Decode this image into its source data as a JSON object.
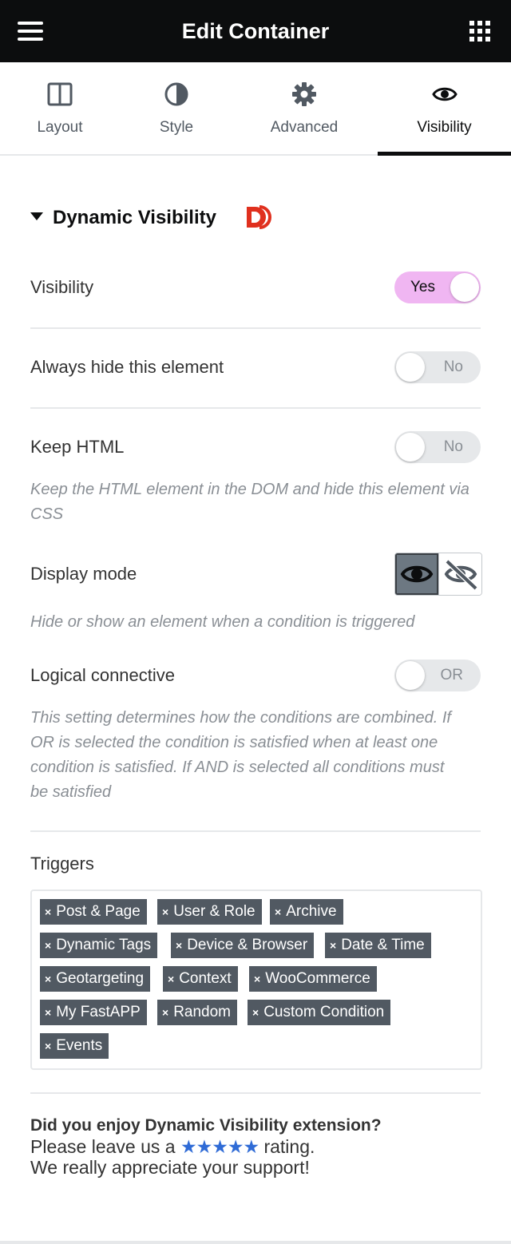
{
  "header": {
    "title": "Edit Container",
    "menu_icon": "hamburger-icon",
    "apps_icon": "grid-icon"
  },
  "tabs": [
    {
      "label": "Layout",
      "icon": "layout-icon"
    },
    {
      "label": "Style",
      "icon": "contrast-icon"
    },
    {
      "label": "Advanced",
      "icon": "gear-icon"
    },
    {
      "label": "Visibility",
      "icon": "eye-icon",
      "active": true
    }
  ],
  "section": {
    "title": "Dynamic Visibility",
    "logo_icon": "dynamic-logo-icon",
    "logo_text": "D"
  },
  "controls": {
    "visibility": {
      "label": "Visibility",
      "state": "Yes"
    },
    "always_hide": {
      "label": "Always hide this element",
      "state": "No"
    },
    "keep_html": {
      "label": "Keep HTML",
      "state": "No",
      "help": "Keep the HTML element in the DOM and hide this element via CSS"
    },
    "display_mode": {
      "label": "Display mode",
      "options": [
        "eye-icon",
        "eye-slash-icon"
      ],
      "selected": "eye-icon",
      "help": "Hide or show an element when a condition is triggered"
    },
    "logical_connective": {
      "label": "Logical connective",
      "state": "OR",
      "help": "This setting determines how the conditions are combined. If OR is selected the condition is satisfied when at least one condition is satisfied. If AND is selected all conditions must be satisfied"
    }
  },
  "triggers": {
    "label": "Triggers",
    "remove_glyph": "×",
    "tags": [
      "Post & Page",
      "User & Role",
      "Archive",
      "Dynamic Tags",
      "Device & Browser",
      "Date & Time",
      "Geotargeting",
      "Context",
      "WooCommerce",
      "My FastAPP",
      "Random",
      "Custom Condition",
      "Events"
    ]
  },
  "footer": {
    "heading": "Did you enjoy Dynamic Visibility extension?",
    "line1_before": "Please leave us a",
    "stars": "★★★★★",
    "line1_after": "rating.",
    "line2": "We really appreciate your support!"
  },
  "colors": {
    "topbar": "#0c0d0e",
    "switch_on": "#f0b6f2",
    "tag_bg": "#515962",
    "stars": "#2f6bd6",
    "logo_red": "#e0301e"
  }
}
